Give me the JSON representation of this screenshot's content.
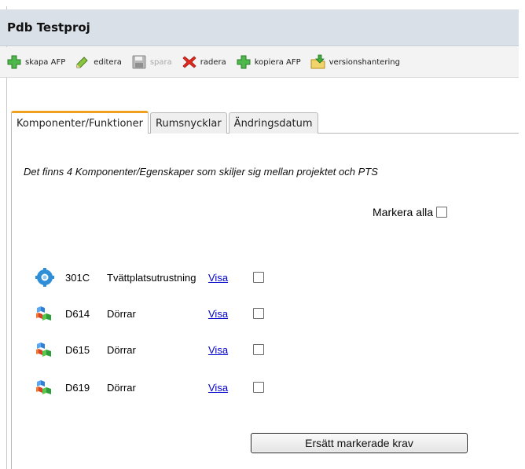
{
  "header": {
    "title": "Pdb Testproj"
  },
  "toolbar": {
    "items": [
      {
        "label": "skapa AFP",
        "icon": "plus-icon",
        "enabled": true
      },
      {
        "label": "editera",
        "icon": "pencil-icon",
        "enabled": true
      },
      {
        "label": "spara",
        "icon": "save-icon",
        "enabled": false
      },
      {
        "label": "radera",
        "icon": "delete-icon",
        "enabled": true
      },
      {
        "label": "kopiera AFP",
        "icon": "plus-icon",
        "enabled": true
      },
      {
        "label": "versionshantering",
        "icon": "folder-arrow-icon",
        "enabled": true
      }
    ]
  },
  "tabs": [
    {
      "label": "Komponenter/Funktioner",
      "active": true
    },
    {
      "label": "Rumsnycklar",
      "active": false
    },
    {
      "label": "Ändringsdatum",
      "active": false
    }
  ],
  "main": {
    "info_text": "Det finns 4 Komponenter/Egenskaper som skiljer sig mellan projektet och PTS",
    "mark_all_label": "Markera alla",
    "items": [
      {
        "code": "301C",
        "name": "Tvättplatsutrustning",
        "link": "Visa",
        "icon": "gear-icon",
        "checked": false
      },
      {
        "code": "D614",
        "name": "Dörrar",
        "link": "Visa",
        "icon": "cubes-icon",
        "checked": false
      },
      {
        "code": "D615",
        "name": "Dörrar",
        "link": "Visa",
        "icon": "cubes-icon",
        "checked": false
      },
      {
        "code": "D619",
        "name": "Dörrar",
        "link": "Visa",
        "icon": "cubes-icon",
        "checked": false
      }
    ],
    "replace_button_label": "Ersätt markerade krav"
  },
  "colors": {
    "title_bar": "#d9e0e8",
    "active_tab_accent": "#f0a020",
    "link": "#0000cc"
  }
}
